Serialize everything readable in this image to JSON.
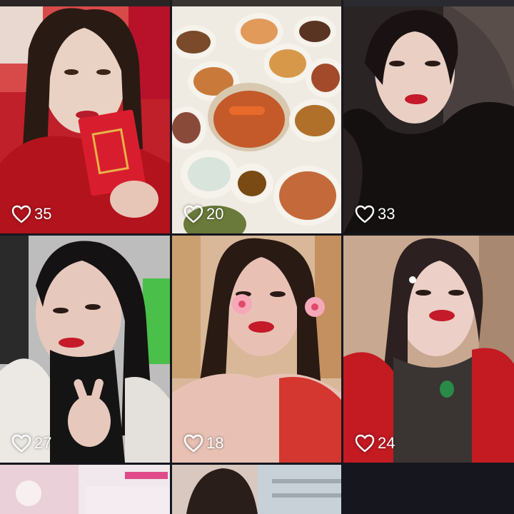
{
  "feed": {
    "posts": [
      {
        "likes": "35",
        "photo": "woman-red-coat-red-envelope",
        "colors": [
          "#b3131c",
          "#e9d2c4",
          "#3a2418"
        ]
      },
      {
        "likes": "20",
        "photo": "banquet-table-dishes",
        "colors": [
          "#c98a4a",
          "#f1ede4",
          "#8a3a1a"
        ]
      },
      {
        "likes": "33",
        "photo": "woman-black-fur-coat",
        "colors": [
          "#1a1616",
          "#ead0c4",
          "#4a3a34"
        ]
      },
      {
        "likes": "27",
        "photo": "woman-white-coat-peace-sign",
        "colors": [
          "#e9e6e2",
          "#e7c8bc",
          "#141414"
        ]
      },
      {
        "likes": "18",
        "photo": "woman-flower-filter",
        "colors": [
          "#d4372f",
          "#e8c1b4",
          "#caa070"
        ]
      },
      {
        "likes": "24",
        "photo": "woman-red-scarf-necklace",
        "colors": [
          "#c41a22",
          "#eccfc6",
          "#2c2622"
        ]
      },
      {
        "likes": "",
        "photo": "partial-party-photo",
        "colors": [
          "#f0e8ec",
          "#e0b0b8"
        ]
      },
      {
        "likes": "",
        "photo": "partial-woman-photo",
        "colors": [
          "#3a2a24",
          "#c8d0d8"
        ]
      }
    ]
  },
  "icons": {
    "like": "heart-outline-icon"
  }
}
